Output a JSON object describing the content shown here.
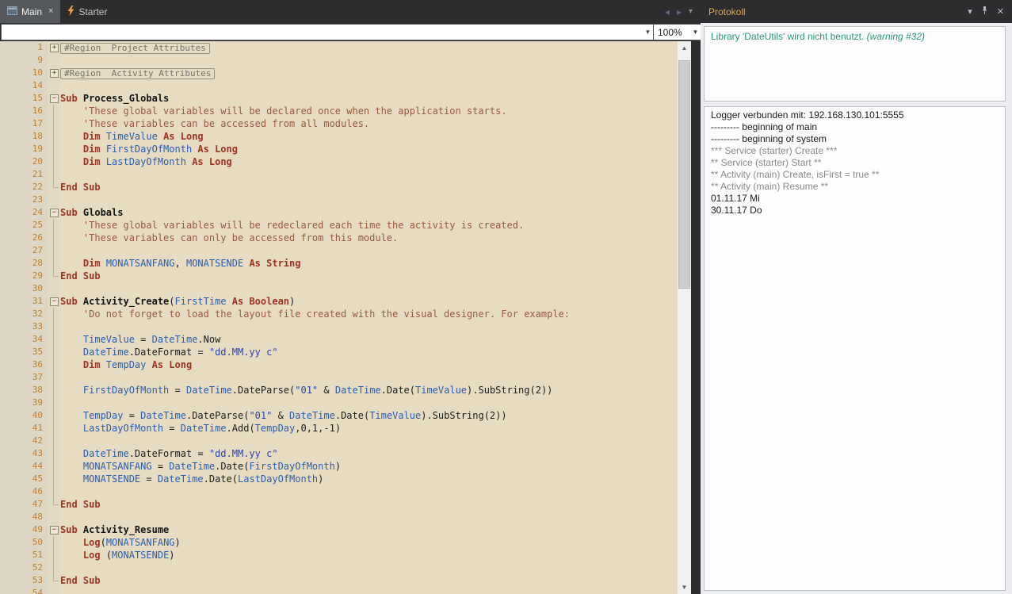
{
  "tabbar": {
    "tabs": [
      {
        "label": "Main",
        "state": "active"
      },
      {
        "label": "Starter",
        "state": "inactive"
      }
    ]
  },
  "toolbar": {
    "module_selector_value": "",
    "zoom_value": "100%"
  },
  "icons": {
    "tab_close": "×",
    "back_arrow": "◂",
    "forward_arrow": "▸",
    "tab_list_dropdown": "▾",
    "combo_dropdown": "▼",
    "scroll_up": "▲",
    "scroll_down": "▼",
    "panel_chevron_down": "▾",
    "panel_close": "✕",
    "fold_collapsed": "+",
    "fold_expanded": "−"
  },
  "colors": {
    "editor_bg": "#e7dcc2",
    "gutter_number": "#c1802e",
    "keyword_red": "#9e3322",
    "identifier_blue": "#2a5db0",
    "comment_brown": "#99583f",
    "string_blue": "#2b43a8",
    "warning_teal": "#2e9678",
    "panel_title_gold": "#e2a648",
    "dark_chrome": "#2d2d30"
  },
  "editor": {
    "lines": [
      {
        "n": 1,
        "f": "plus",
        "t": [
          [
            "rg",
            "#Region  Project Attributes"
          ]
        ]
      },
      {
        "n": 9,
        "f": "",
        "t": []
      },
      {
        "n": 10,
        "f": "plus",
        "t": [
          [
            "rg",
            "#Region  Activity Attributes"
          ]
        ]
      },
      {
        "n": 14,
        "f": "",
        "t": []
      },
      {
        "n": 15,
        "f": "minus",
        "t": [
          [
            "kw",
            "Sub "
          ],
          [
            "sn",
            "Process_Globals"
          ]
        ]
      },
      {
        "n": 16,
        "f": "guide",
        "t": [
          [
            "pl",
            "    "
          ],
          [
            "cm",
            "'These global variables will be declared once when the application starts."
          ]
        ]
      },
      {
        "n": 17,
        "f": "guide",
        "t": [
          [
            "pl",
            "    "
          ],
          [
            "cm",
            "'These variables can be accessed from all modules."
          ]
        ]
      },
      {
        "n": 18,
        "f": "guide",
        "t": [
          [
            "pl",
            "    "
          ],
          [
            "kw",
            "Dim "
          ],
          [
            "id",
            "TimeValue"
          ],
          [
            "kw",
            " As Long"
          ]
        ]
      },
      {
        "n": 19,
        "f": "guide",
        "t": [
          [
            "pl",
            "    "
          ],
          [
            "kw",
            "Dim "
          ],
          [
            "id",
            "FirstDayOfMonth"
          ],
          [
            "kw",
            " As Long"
          ]
        ]
      },
      {
        "n": 20,
        "f": "guide",
        "t": [
          [
            "pl",
            "    "
          ],
          [
            "kw",
            "Dim "
          ],
          [
            "id",
            "LastDayOfMonth"
          ],
          [
            "kw",
            " As Long"
          ]
        ]
      },
      {
        "n": 21,
        "f": "guide",
        "t": []
      },
      {
        "n": 22,
        "f": "end",
        "t": [
          [
            "kw",
            "End Sub"
          ]
        ]
      },
      {
        "n": 23,
        "f": "",
        "t": []
      },
      {
        "n": 24,
        "f": "minus",
        "t": [
          [
            "kw",
            "Sub "
          ],
          [
            "sn",
            "Globals"
          ]
        ]
      },
      {
        "n": 25,
        "f": "guide",
        "t": [
          [
            "pl",
            "    "
          ],
          [
            "cm",
            "'These global variables will be redeclared each time the activity is created."
          ]
        ]
      },
      {
        "n": 26,
        "f": "guide",
        "t": [
          [
            "pl",
            "    "
          ],
          [
            "cm",
            "'These variables can only be accessed from this module."
          ]
        ]
      },
      {
        "n": 27,
        "f": "guide",
        "t": []
      },
      {
        "n": 28,
        "f": "guide",
        "t": [
          [
            "pl",
            "    "
          ],
          [
            "kw",
            "Dim "
          ],
          [
            "id",
            "MONATSANFANG"
          ],
          [
            "pl",
            ", "
          ],
          [
            "id",
            "MONATSENDE"
          ],
          [
            "kw",
            " As String"
          ]
        ]
      },
      {
        "n": 29,
        "f": "end",
        "t": [
          [
            "kw",
            "End Sub"
          ]
        ]
      },
      {
        "n": 30,
        "f": "",
        "t": []
      },
      {
        "n": 31,
        "f": "minus",
        "t": [
          [
            "kw",
            "Sub "
          ],
          [
            "sn",
            "Activity_Create"
          ],
          [
            "pl",
            "("
          ],
          [
            "id",
            "FirstTime"
          ],
          [
            "kw",
            " As Boolean"
          ],
          [
            "pl",
            ")"
          ]
        ]
      },
      {
        "n": 32,
        "f": "guide",
        "t": [
          [
            "pl",
            "    "
          ],
          [
            "cm",
            "'Do not forget to load the layout file created with the visual designer. For example:"
          ]
        ]
      },
      {
        "n": 33,
        "f": "guide",
        "t": []
      },
      {
        "n": 34,
        "f": "guide",
        "t": [
          [
            "pl",
            "    "
          ],
          [
            "id",
            "TimeValue"
          ],
          [
            "pl",
            " = "
          ],
          [
            "id",
            "DateTime"
          ],
          [
            "pl",
            ".Now"
          ]
        ]
      },
      {
        "n": 35,
        "f": "guide",
        "t": [
          [
            "pl",
            "    "
          ],
          [
            "id",
            "DateTime"
          ],
          [
            "pl",
            ".DateFormat = "
          ],
          [
            "st",
            "\"dd.MM.yy c\""
          ]
        ]
      },
      {
        "n": 36,
        "f": "guide",
        "t": [
          [
            "pl",
            "    "
          ],
          [
            "kw",
            "Dim "
          ],
          [
            "id",
            "TempDay"
          ],
          [
            "kw",
            " As Long"
          ]
        ]
      },
      {
        "n": 37,
        "f": "guide",
        "t": []
      },
      {
        "n": 38,
        "f": "guide",
        "t": [
          [
            "pl",
            "    "
          ],
          [
            "id",
            "FirstDayOfMonth"
          ],
          [
            "pl",
            " = "
          ],
          [
            "id",
            "DateTime"
          ],
          [
            "pl",
            ".DateParse("
          ],
          [
            "st",
            "\"01\""
          ],
          [
            "pl",
            " & "
          ],
          [
            "id",
            "DateTime"
          ],
          [
            "pl",
            ".Date("
          ],
          [
            "id",
            "TimeValue"
          ],
          [
            "pl",
            ").SubString(2))"
          ]
        ]
      },
      {
        "n": 39,
        "f": "guide",
        "t": []
      },
      {
        "n": 40,
        "f": "guide",
        "t": [
          [
            "pl",
            "    "
          ],
          [
            "id",
            "TempDay"
          ],
          [
            "pl",
            " = "
          ],
          [
            "id",
            "DateTime"
          ],
          [
            "pl",
            ".DateParse("
          ],
          [
            "st",
            "\"01\""
          ],
          [
            "pl",
            " & "
          ],
          [
            "id",
            "DateTime"
          ],
          [
            "pl",
            ".Date("
          ],
          [
            "id",
            "TimeValue"
          ],
          [
            "pl",
            ").SubString(2))"
          ]
        ]
      },
      {
        "n": 41,
        "f": "guide",
        "t": [
          [
            "pl",
            "    "
          ],
          [
            "id",
            "LastDayOfMonth"
          ],
          [
            "pl",
            " = "
          ],
          [
            "id",
            "DateTime"
          ],
          [
            "pl",
            ".Add("
          ],
          [
            "id",
            "TempDay"
          ],
          [
            "pl",
            ",0,1,-1)"
          ]
        ]
      },
      {
        "n": 42,
        "f": "guide",
        "t": []
      },
      {
        "n": 43,
        "f": "guide",
        "t": [
          [
            "pl",
            "    "
          ],
          [
            "id",
            "DateTime"
          ],
          [
            "pl",
            ".DateFormat = "
          ],
          [
            "st",
            "\"dd.MM.yy c\""
          ]
        ]
      },
      {
        "n": 44,
        "f": "guide",
        "t": [
          [
            "pl",
            "    "
          ],
          [
            "id",
            "MONATSANFANG"
          ],
          [
            "pl",
            " = "
          ],
          [
            "id",
            "DateTime"
          ],
          [
            "pl",
            ".Date("
          ],
          [
            "id",
            "FirstDayOfMonth"
          ],
          [
            "pl",
            ")"
          ]
        ]
      },
      {
        "n": 45,
        "f": "guide",
        "t": [
          [
            "pl",
            "    "
          ],
          [
            "id",
            "MONATSENDE"
          ],
          [
            "pl",
            " = "
          ],
          [
            "id",
            "DateTime"
          ],
          [
            "pl",
            ".Date("
          ],
          [
            "id",
            "LastDayOfMonth"
          ],
          [
            "pl",
            ")"
          ]
        ]
      },
      {
        "n": 46,
        "f": "guide",
        "t": []
      },
      {
        "n": 47,
        "f": "end",
        "t": [
          [
            "kw",
            "End Sub"
          ]
        ]
      },
      {
        "n": 48,
        "f": "",
        "t": []
      },
      {
        "n": 49,
        "f": "minus",
        "t": [
          [
            "kw",
            "Sub "
          ],
          [
            "sn",
            "Activity_Resume"
          ]
        ]
      },
      {
        "n": 50,
        "f": "guide",
        "t": [
          [
            "pl",
            "    "
          ],
          [
            "kw",
            "Log"
          ],
          [
            "pl",
            "("
          ],
          [
            "id",
            "MONATSANFANG"
          ],
          [
            "pl",
            ")"
          ]
        ]
      },
      {
        "n": 51,
        "f": "guide",
        "t": [
          [
            "pl",
            "    "
          ],
          [
            "kw",
            "Log"
          ],
          [
            "pl",
            " ("
          ],
          [
            "id",
            "MONATSENDE"
          ],
          [
            "pl",
            ")"
          ]
        ]
      },
      {
        "n": 52,
        "f": "guide",
        "t": []
      },
      {
        "n": 53,
        "f": "end",
        "t": [
          [
            "kw",
            "End Sub"
          ]
        ]
      },
      {
        "n": 54,
        "f": "",
        "t": []
      }
    ]
  },
  "protokoll": {
    "title": "Protokoll",
    "warning_text": "Library 'DateUtils' wird nicht benutzt.",
    "warning_suffix": " (warning #32)",
    "log_lines": [
      {
        "text": "Logger verbunden mit: 192.168.130.101:5555",
        "color": "black"
      },
      {
        "text": "--------- beginning of main",
        "color": "black"
      },
      {
        "text": "--------- beginning of system",
        "color": "black"
      },
      {
        "text": "*** Service (starter) Create ***",
        "color": "gray"
      },
      {
        "text": "** Service (starter) Start **",
        "color": "gray"
      },
      {
        "text": "** Activity (main) Create, isFirst = true **",
        "color": "gray"
      },
      {
        "text": "** Activity (main) Resume **",
        "color": "gray"
      },
      {
        "text": "01.11.17 Mi",
        "color": "black"
      },
      {
        "text": "30.11.17 Do",
        "color": "black"
      }
    ]
  }
}
